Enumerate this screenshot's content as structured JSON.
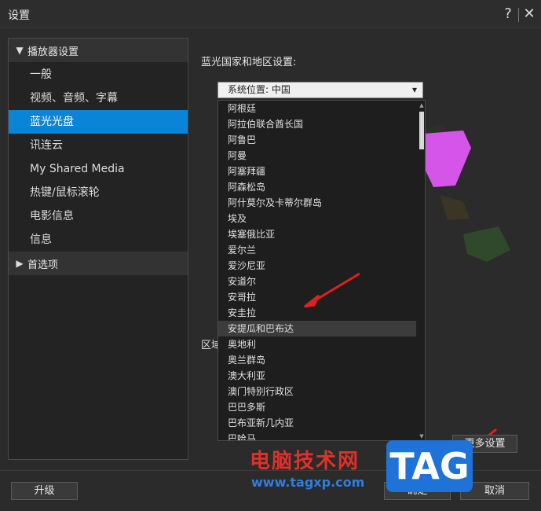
{
  "window": {
    "title": "设置",
    "help_symbol": "?",
    "close_symbol": "✕"
  },
  "sidebar": {
    "section1": {
      "label": "播放器设置",
      "chevron": "▼"
    },
    "items": [
      {
        "label": "一般"
      },
      {
        "label": "视频、音频、字幕"
      },
      {
        "label": "蓝光光盘",
        "active": true
      },
      {
        "label": "讯连云"
      },
      {
        "label": "My Shared Media"
      },
      {
        "label": "热键/鼠标滚轮"
      },
      {
        "label": "电影信息"
      },
      {
        "label": "信息"
      }
    ],
    "section2": {
      "label": "首选项",
      "chevron": "▶"
    }
  },
  "main": {
    "heading": "蓝光国家和地区设置:",
    "combo_value": "系统位置: 中国",
    "region_label_partial": "区域",
    "more_settings_label": "更多设置"
  },
  "dropdown": {
    "items": [
      "阿根廷",
      "阿拉伯联合酋长国",
      "阿鲁巴",
      "阿曼",
      "阿塞拜疆",
      "阿森松岛",
      "阿什莫尔及卡蒂尔群岛",
      "埃及",
      "埃塞俄比亚",
      "爱尔兰",
      "爱沙尼亚",
      "安道尔",
      "安哥拉",
      "安圭拉",
      "安提瓜和巴布达",
      "奥地利",
      "奥兰群岛",
      "澳大利亚",
      "澳门特别行政区",
      "巴巴多斯",
      "巴布亚新几内亚",
      "巴哈马"
    ],
    "hover_index": 14,
    "scroll_position": 0.03
  },
  "footer": {
    "upgrade_label": "升级",
    "ok_label": "确定",
    "cancel_label": "取消"
  },
  "watermark": {
    "site_name": "电脑技术网",
    "url": "www.tagxp.com",
    "logo_text": "TAG"
  },
  "colors": {
    "accent": "#0a84d6",
    "annotation_arrow": "#e02020",
    "map_highlight": "#d455e8"
  }
}
